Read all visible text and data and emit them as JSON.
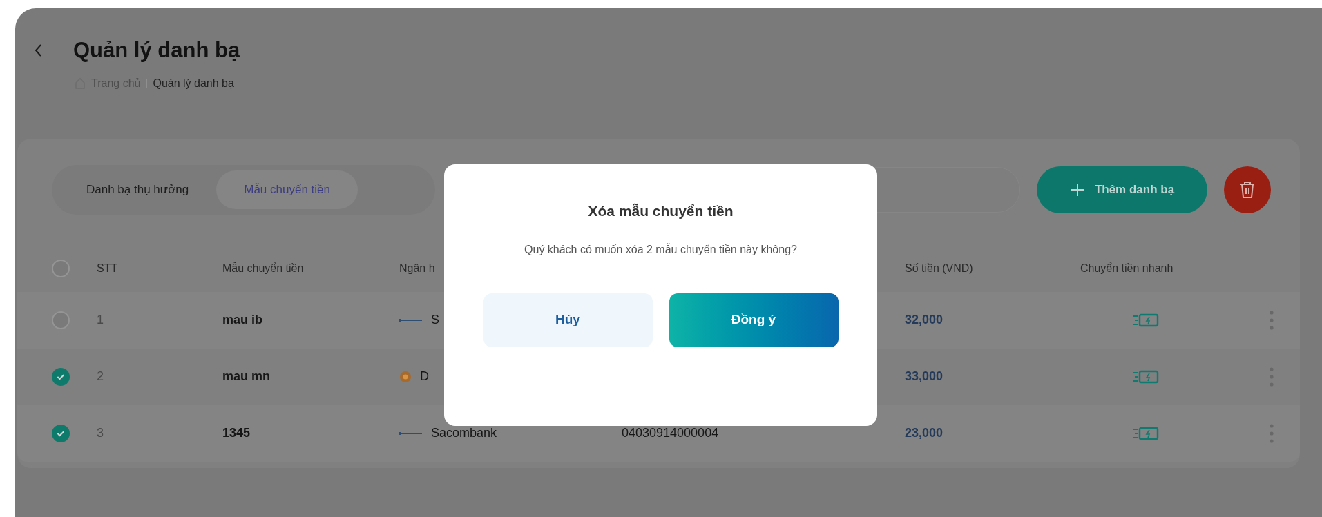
{
  "page": {
    "title": "Quản lý danh bạ",
    "breadcrumb": [
      {
        "label": "Trang chủ",
        "current": false
      },
      {
        "label": "Quản lý danh bạ",
        "current": true
      }
    ]
  },
  "tabs": [
    {
      "label": "Danh bạ thụ hưởng",
      "selected": false
    },
    {
      "label": "Mẫu chuyển tiền",
      "selected": true
    }
  ],
  "actions": {
    "add_label": "Thêm danh bạ"
  },
  "table": {
    "all_checked": false,
    "columns": [
      "STT",
      "Mẫu chuyển tiền",
      "Ngân h",
      "Số tiền (VND)",
      "Chuyển tiền nhanh"
    ],
    "rows": [
      {
        "checked": false,
        "stt": "1",
        "name": "mau ib",
        "bank": {
          "kind": "line",
          "name": "S"
        },
        "amount": "32,000"
      },
      {
        "checked": true,
        "stt": "2",
        "name": "mau mn",
        "bank": {
          "kind": "dot",
          "name": "D"
        },
        "amount": "33,000"
      },
      {
        "checked": true,
        "stt": "3",
        "name": "1345",
        "bank": {
          "kind": "line",
          "name": "Sacombank"
        },
        "account": "04030914000004",
        "amount": "23,000"
      }
    ]
  },
  "dialog": {
    "title": "Xóa mẫu chuyển tiền",
    "message": "Quý khách có muốn xóa 2 mẫu chuyển tiền này không?",
    "buttons": [
      {
        "label": "Hủy",
        "kind": "secondary"
      },
      {
        "label": "Đồng ý",
        "kind": "primary"
      }
    ]
  }
}
